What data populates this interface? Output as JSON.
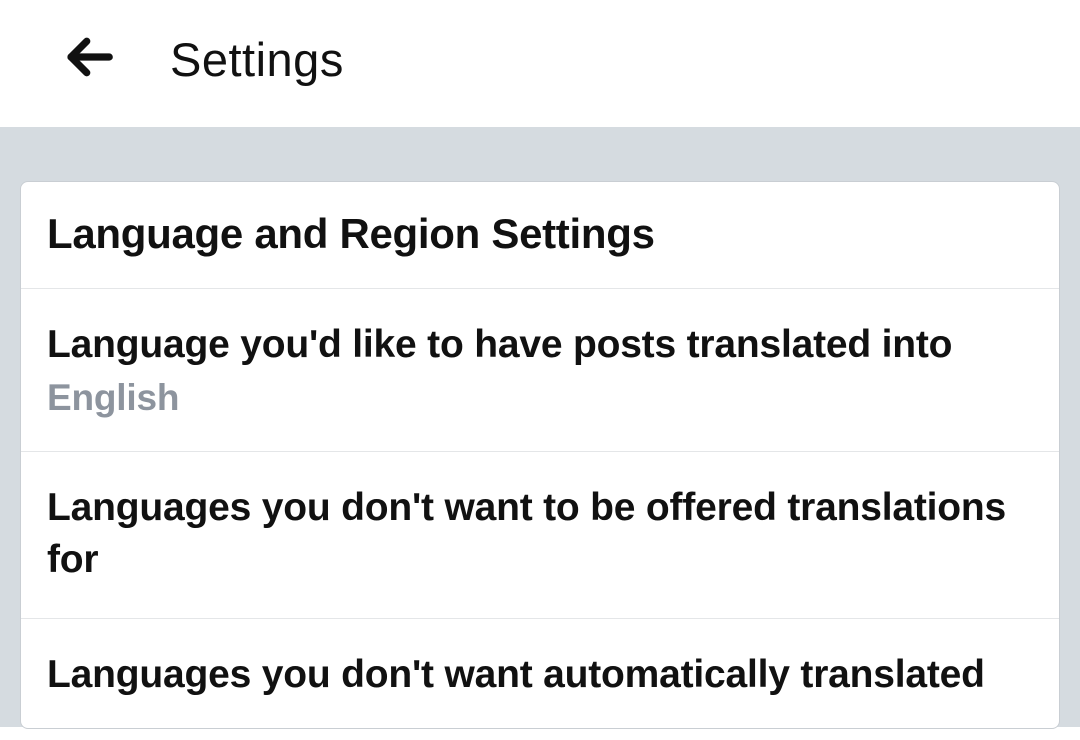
{
  "header": {
    "title": "Settings"
  },
  "section": {
    "title": "Language and Region Settings",
    "items": [
      {
        "label": "Language you'd like to have posts translated into",
        "value": "English"
      },
      {
        "label": "Languages you don't want to be offered translations for",
        "value": ""
      },
      {
        "label": "Languages you don't want automatically translated",
        "value": ""
      }
    ]
  }
}
